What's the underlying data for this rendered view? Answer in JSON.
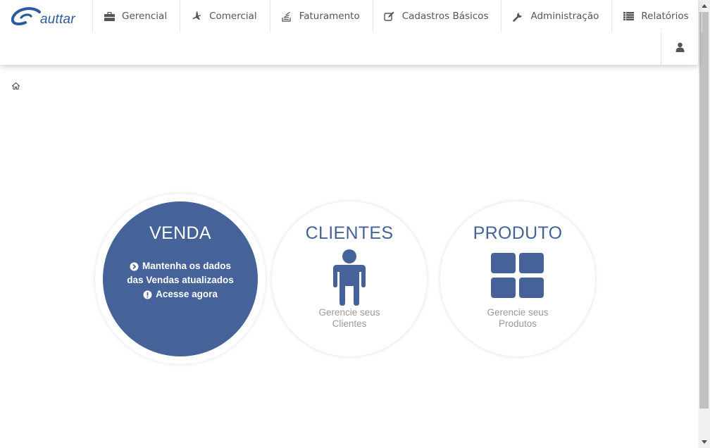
{
  "logo": {
    "text": "auttar"
  },
  "menu": [
    {
      "label": "Gerencial",
      "icon": "briefcase-icon"
    },
    {
      "label": "Comercial",
      "icon": "airplane-icon"
    },
    {
      "label": "Faturamento",
      "icon": "stack-icon"
    },
    {
      "label": "Cadastros Básicos",
      "icon": "edit-icon"
    },
    {
      "label": "Administração",
      "icon": "wrench-icon"
    },
    {
      "label": "Relatórios",
      "icon": "list-icon"
    }
  ],
  "user": {
    "icon": "user-icon"
  },
  "breadcrumb": {
    "icon": "home-icon"
  },
  "colors": {
    "brand": "#466399",
    "logo": "#2c5aa0",
    "muted": "#999999"
  },
  "tiles": {
    "venda": {
      "title": "VENDA",
      "line1": "Mantenha os dados",
      "line2": "das Vendas atualizados",
      "line3": "Acesse agora"
    },
    "clientes": {
      "title": "CLIENTES",
      "desc1": "Gerencie seus",
      "desc2": "Clientes"
    },
    "produto": {
      "title": "PRODUTO",
      "desc1": "Gerencie seus",
      "desc2": "Produtos"
    }
  }
}
